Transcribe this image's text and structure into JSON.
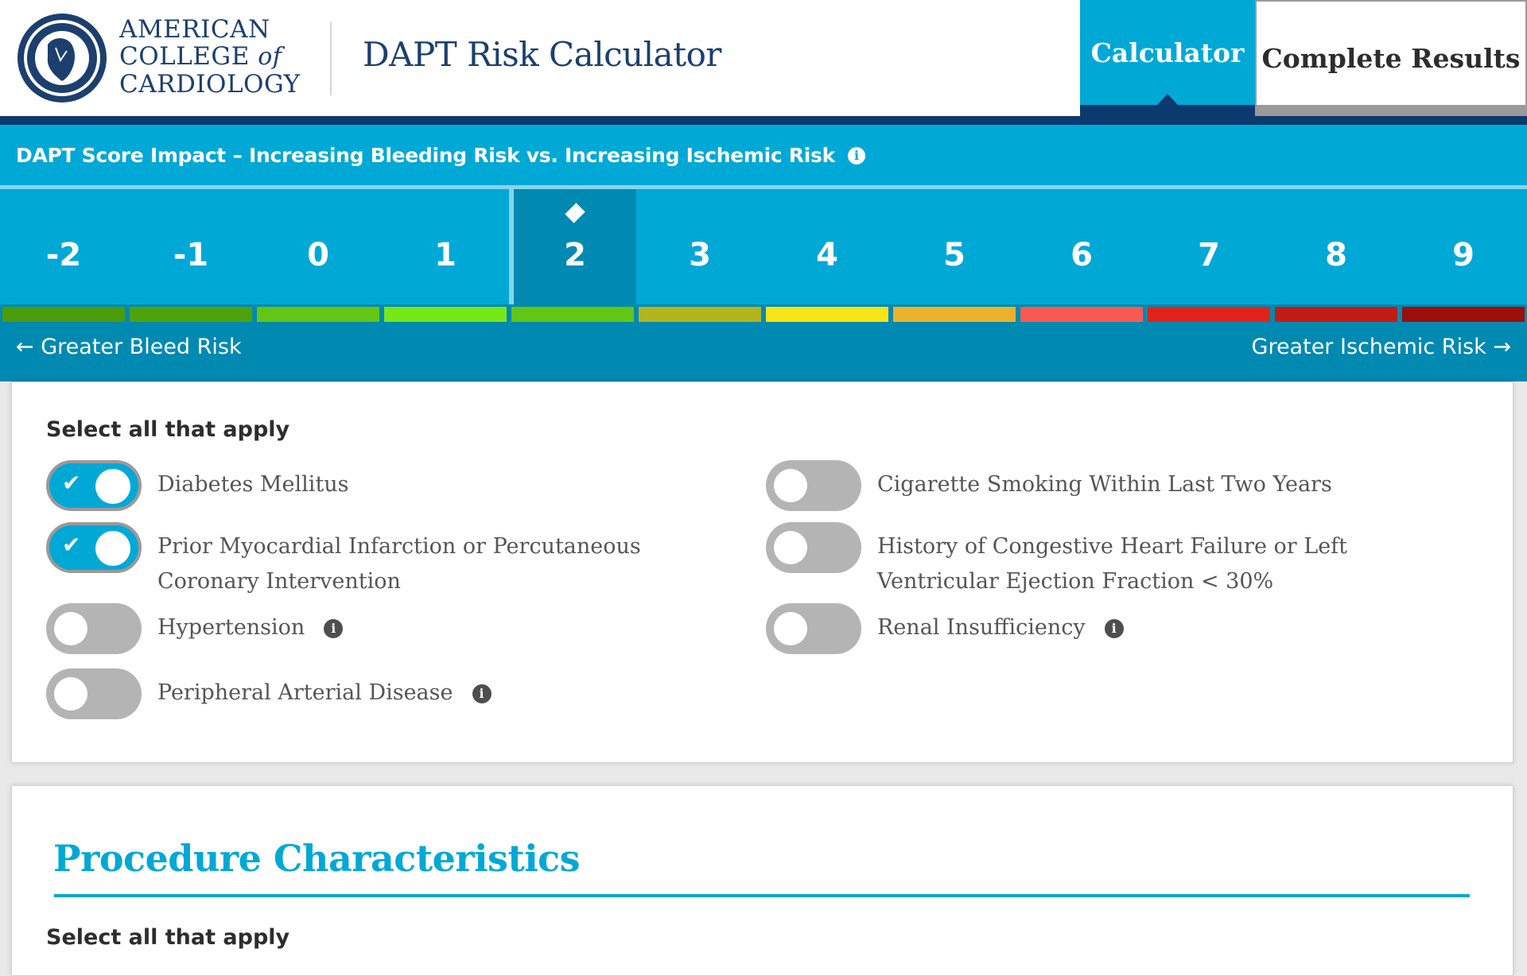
{
  "header": {
    "logo_lines": [
      "AMERICAN",
      "COLLEGE",
      "of",
      "CARDIOLOGY"
    ],
    "app_title": "DAPT Risk Calculator",
    "tabs": [
      {
        "label": "Calculator",
        "active": true
      },
      {
        "label": "Complete Results",
        "active": false
      }
    ]
  },
  "score_impact": {
    "title": "DAPT Score Impact – Increasing Bleeding Risk vs. Increasing Ischemic Risk",
    "info_icon": "i",
    "scale_values": [
      "-2",
      "-1",
      "0",
      "1",
      "2",
      "3",
      "4",
      "5",
      "6",
      "7",
      "8",
      "9"
    ],
    "current_score": "2",
    "segment_colors": [
      "#4a9c0a",
      "#4ea30b",
      "#63c614",
      "#76e817",
      "#63c614",
      "#b3b51c",
      "#f5e416",
      "#ecb22e",
      "#f75a52",
      "#e2231a",
      "#c11b16",
      "#9b0e0a"
    ],
    "left_label": "Greater Bleed Risk",
    "right_label": "Greater Ischemic Risk",
    "left_arrow": "←",
    "right_arrow": "→"
  },
  "patient_section": {
    "subheading": "Select all that apply",
    "check_glyph": "✔",
    "info_glyph": "i",
    "left_items": [
      {
        "label": "Diabetes Mellitus",
        "checked": true,
        "info": false
      },
      {
        "label": "Prior Myocardial Infarction or Percutaneous Coronary Intervention",
        "checked": true,
        "info": false
      },
      {
        "label": "Hypertension",
        "checked": false,
        "info": true
      },
      {
        "label": "Peripheral Arterial Disease",
        "checked": false,
        "info": true
      }
    ],
    "right_items": [
      {
        "label": "Cigarette Smoking Within Last Two Years",
        "checked": false,
        "info": false
      },
      {
        "label": "History of Congestive Heart Failure or Left Ventricular Ejection Fraction < 30%",
        "checked": false,
        "info": false
      },
      {
        "label": "Renal Insufficiency",
        "checked": false,
        "info": true
      }
    ]
  },
  "procedure_section": {
    "title": "Procedure Characteristics",
    "subheading": "Select all that apply"
  },
  "colors": {
    "brand_blue": "#00a8d6",
    "navy": "#0d3a6e",
    "dark_blue": "#0089b1"
  }
}
